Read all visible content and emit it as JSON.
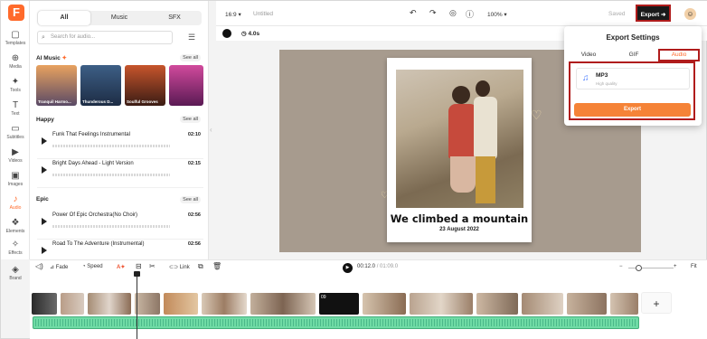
{
  "app": {
    "logo": "F"
  },
  "rail": [
    {
      "label": "Templates",
      "icon": "▢"
    },
    {
      "label": "Media",
      "icon": "⊕"
    },
    {
      "label": "Tools",
      "icon": "✦"
    },
    {
      "label": "Text",
      "icon": "T"
    },
    {
      "label": "Subtitles",
      "icon": "▭"
    },
    {
      "label": "Videos",
      "icon": "▶"
    },
    {
      "label": "Images",
      "icon": "▣"
    },
    {
      "label": "Audio",
      "icon": "♪"
    },
    {
      "label": "Elements",
      "icon": "❖"
    },
    {
      "label": "Effects",
      "icon": "✧"
    },
    {
      "label": "Brand",
      "icon": "◈"
    }
  ],
  "library": {
    "tabs": [
      "All",
      "Music",
      "SFX"
    ],
    "search_placeholder": "Search for audio...",
    "ai_music": {
      "title": "AI Music",
      "see_all": "See all",
      "thumbs": [
        "Tranquil Harmo...",
        "Thunderous D...",
        "Soulful Grooves",
        ""
      ]
    },
    "happy": {
      "title": "Happy",
      "see_all": "See all",
      "tracks": [
        {
          "name": "Funk That Feelings Instrumental",
          "dur": "02:10"
        },
        {
          "name": "Bright Days Ahead - Light Version",
          "dur": "02:15"
        }
      ]
    },
    "epic": {
      "title": "Epic",
      "see_all": "See all",
      "tracks": [
        {
          "name": "Power Of Epic Orchestra(No Choir)",
          "dur": "02:56"
        },
        {
          "name": "Road To The Adventure (Instrumental)",
          "dur": "02:56"
        }
      ]
    }
  },
  "topbar": {
    "ratio": "16:9",
    "title": "Untitled",
    "zoom": "100%",
    "saved": "Saved",
    "export": "Export"
  },
  "subbar": {
    "duration": "4.0s"
  },
  "canvas": {
    "caption": "We climbed a mountain",
    "date": "23 August 2022"
  },
  "export_popup": {
    "title": "Export Settings",
    "tabs": [
      "Video",
      "GIF",
      "Audio"
    ],
    "selected_tab": "Audio",
    "format": {
      "name": "MP3",
      "quality": "High quality"
    },
    "button": "Export"
  },
  "toolbar": {
    "fade": "Fade",
    "speed": "Speed",
    "link": "Link",
    "time_current": "00:12.0",
    "time_total": "01:09.0",
    "fit": "Fit"
  },
  "timeline": {
    "clip_label": "09"
  },
  "colors": {
    "accent": "#ff6a2b",
    "export_btn": "#f58337",
    "audio_track": "#6fdba5",
    "highlight": "#b01c1c"
  }
}
